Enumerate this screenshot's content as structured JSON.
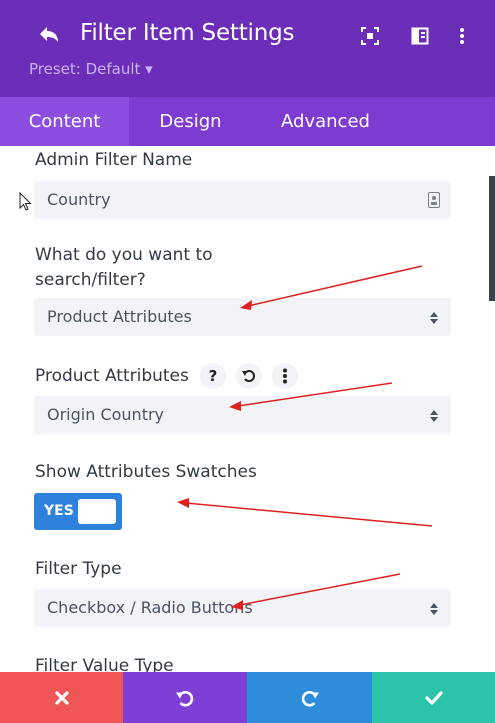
{
  "header": {
    "title": "Filter Item Settings",
    "preset": "Preset: Default ▾",
    "icons": [
      "back-icon",
      "focus-icon",
      "sidebar-layout-icon",
      "more-vertical-icon"
    ]
  },
  "tabs": [
    {
      "label": "Content",
      "active": true
    },
    {
      "label": "Design",
      "active": false
    },
    {
      "label": "Advanced",
      "active": false
    }
  ],
  "form": {
    "admin_filter_name": {
      "label": "Admin Filter Name",
      "value": "Country"
    },
    "search_filter": {
      "label_line1": "What do you want to",
      "label_line2": "search/filter?",
      "value": "Product Attributes"
    },
    "product_attributes": {
      "label": "Product Attributes",
      "value": "Origin Country",
      "help": "?"
    },
    "show_swatches": {
      "label": "Show Attributes Swatches",
      "toggle": "YES",
      "on": true
    },
    "filter_type": {
      "label": "Filter Type",
      "value": "Checkbox / Radio Buttons"
    },
    "filter_value_type": {
      "label": "Filter Value Type"
    }
  },
  "footer": {
    "buttons": [
      {
        "name": "cancel-button",
        "icon": "close-icon",
        "color": "#ef5555"
      },
      {
        "name": "undo-button",
        "icon": "undo-icon",
        "color": "#7e3fd6"
      },
      {
        "name": "redo-button",
        "icon": "redo-icon",
        "color": "#2e8ddb"
      },
      {
        "name": "save-button",
        "icon": "check-icon",
        "color": "#29c4a9"
      }
    ]
  },
  "colors": {
    "header": "#6c2eb9",
    "tabs": "#7d3bd2",
    "active_tab": "#8d4ee0",
    "toggle": "#2e82db",
    "annotation_arrow": "#e02020"
  }
}
